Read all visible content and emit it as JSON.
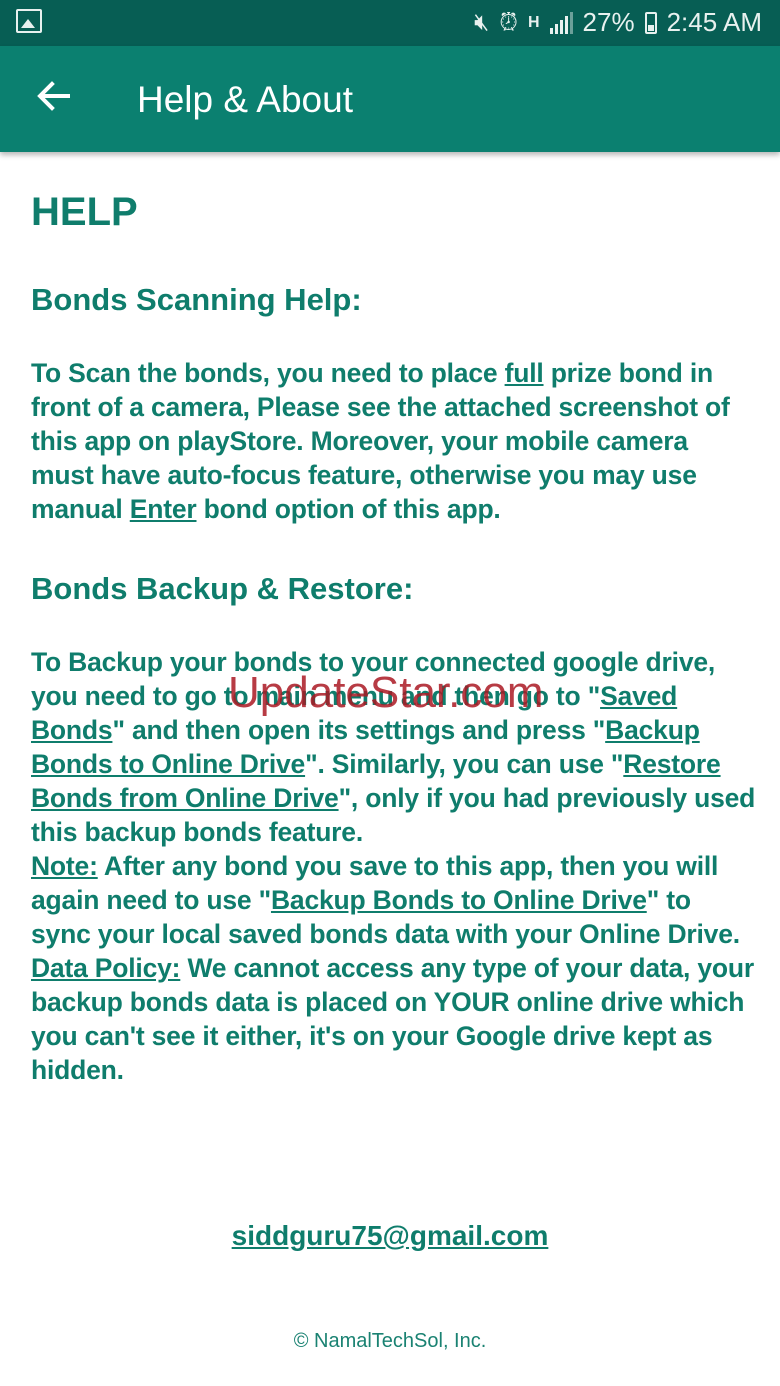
{
  "status_bar": {
    "battery": "27%",
    "time": "2:45 AM",
    "network": "H"
  },
  "app_bar": {
    "title": "Help & About"
  },
  "help": {
    "heading": "HELP",
    "scanning": {
      "title": "Bonds Scanning Help:",
      "t1": "To Scan the bonds, you need to place ",
      "link_full": "full",
      "t2": " prize bond in front of a camera, Please see the attached screenshot of this app on playStore. Moreover, your mobile camera must have auto-focus feature, otherwise you may use manual ",
      "link_enter": "Enter",
      "t3": " bond option of this app."
    },
    "backup": {
      "title": "Bonds Backup & Restore:",
      "t1": "To Backup your bonds to your connected google drive, you need to go to main menu and then go to \"",
      "link_saved": "Saved Bonds",
      "t2": "\" and then open its settings and press \"",
      "link_backup": "Backup Bonds to Online Drive",
      "t3": "\". Similarly, you can use \"",
      "link_restore": "Restore Bonds from Online Drive",
      "t4": "\", only if you had previously used this backup bonds feature.",
      "note_label": "Note:",
      "note_t1": " After any bond you save to this app, then you will again need to use \"",
      "note_link": "Backup Bonds to Online Drive",
      "note_t2": "\" to sync your local saved bonds data with your Online Drive.",
      "policy_label": "Data Policy:",
      "policy_text": " We cannot access any type of your data, your backup bonds data is placed on YOUR online drive which you can't see it either, it's on your Google drive kept as hidden."
    }
  },
  "email": "siddguru75@gmail.com",
  "copyright": "© NamalTechSol, Inc.",
  "watermark": "UpdateStar.com",
  "colors": {
    "primary": "#0b8070",
    "status_bar": "#075e54",
    "text": "#0f7d6c"
  }
}
